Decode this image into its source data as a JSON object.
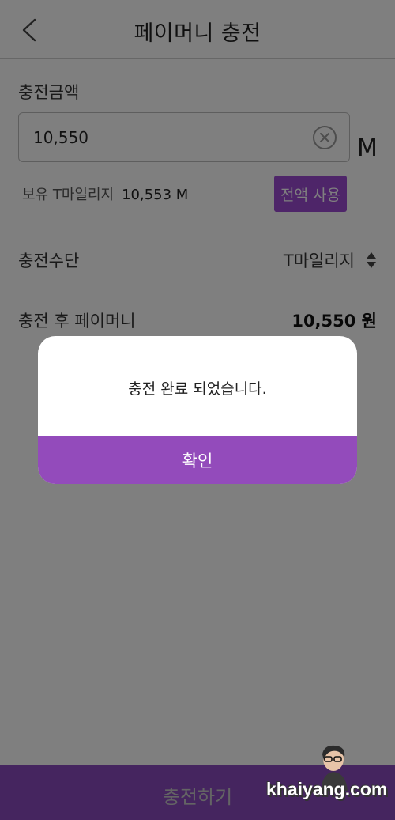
{
  "header": {
    "title": "페이머니 충전",
    "back_icon": "chevron-left-icon"
  },
  "amount": {
    "label": "충전금액",
    "value": "10,550",
    "unit": "M",
    "clear_icon": "clear-circle-icon"
  },
  "balance": {
    "label": "보유 T마일리지",
    "value": "10,553 M",
    "use_all_label": "전액 사용"
  },
  "method": {
    "label": "충전수단",
    "value": "T마일리지",
    "sort_icon": "sort-updown-icon"
  },
  "after": {
    "label": "충전 후 페이머니",
    "value": "10,550 원"
  },
  "bottom": {
    "charge_label": "충전하기"
  },
  "dialog": {
    "message": "충전 완료 되었습니다.",
    "confirm_label": "확인"
  },
  "watermark": {
    "text": "khaiyang.com"
  },
  "colors": {
    "accent": "#934bbb",
    "accent_button": "#9d4bd3",
    "overlay": "rgba(0,0,0,0.5)"
  }
}
